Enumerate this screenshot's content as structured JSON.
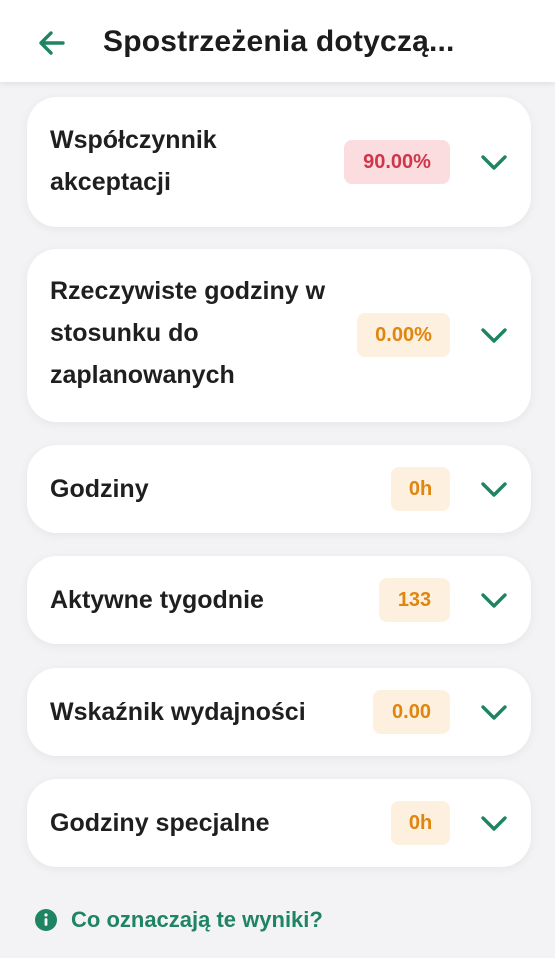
{
  "header": {
    "title": "Spostrzeżenia dotyczą...",
    "back_icon": "arrow-left-icon"
  },
  "colors": {
    "accent": "#1f8462",
    "badge_red_bg": "#fbdcdf",
    "badge_red_text": "#d0364a",
    "badge_orange_bg": "#fdf0de",
    "badge_orange_text": "#e0850f"
  },
  "metrics": [
    {
      "label_lines": [
        "Współczynnik",
        "akceptacji"
      ],
      "value": "90.00%",
      "status": "red"
    },
    {
      "label_lines": [
        "Rzeczywiste godziny w",
        "stosunku do",
        "zaplanowanych"
      ],
      "value": "0.00%",
      "status": "orange"
    },
    {
      "label_lines": [
        "Godziny"
      ],
      "value": "0h",
      "status": "orange"
    },
    {
      "label_lines": [
        "Aktywne tygodnie"
      ],
      "value": "133",
      "status": "orange"
    },
    {
      "label_lines": [
        "Wskaźnik wydajności"
      ],
      "value": "0.00",
      "status": "orange"
    },
    {
      "label_lines": [
        "Godziny specjalne"
      ],
      "value": "0h",
      "status": "orange"
    }
  ],
  "help": {
    "icon": "info-circle-icon",
    "label": "Co oznaczają te wyniki?"
  }
}
